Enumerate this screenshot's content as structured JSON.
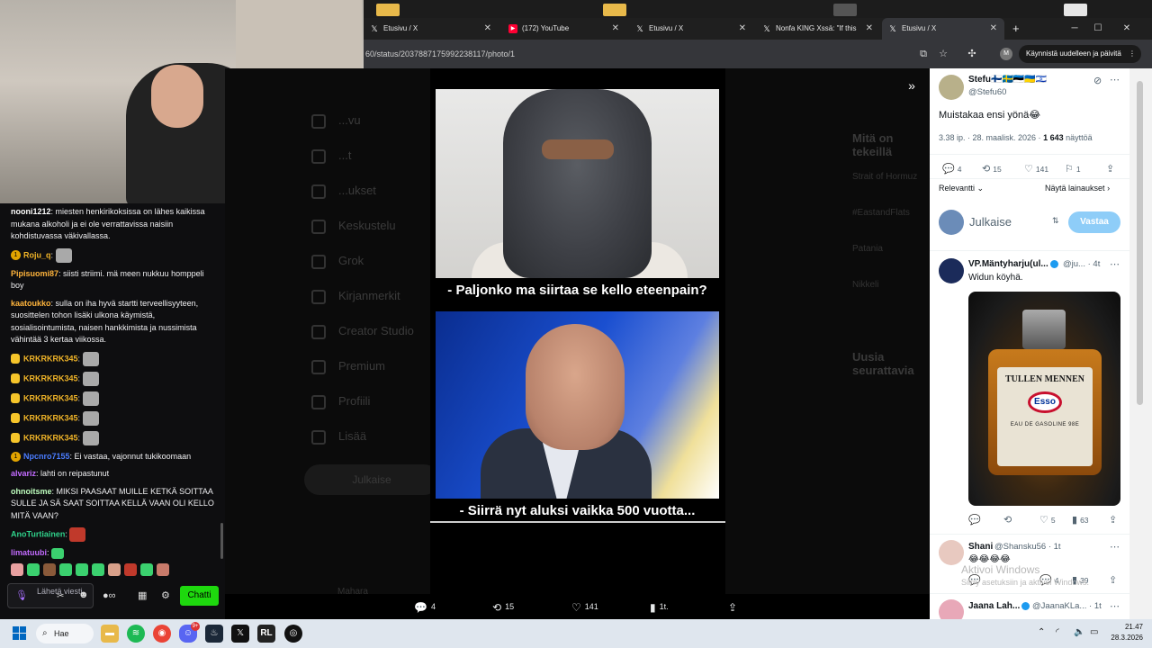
{
  "browser": {
    "tabs": [
      {
        "title": "Etusivu / X",
        "icon": "x-logo-icon"
      },
      {
        "title": "(172) YouTube",
        "icon": "youtube-icon"
      },
      {
        "title": "Etusivu / X",
        "icon": "x-logo-icon"
      },
      {
        "title": "Nonfa KING Xssä: \"If this",
        "icon": "x-logo-icon"
      },
      {
        "title": "Etusivu / X",
        "icon": "x-logo-icon",
        "active": true
      }
    ],
    "url": "60/status/2037887175992238117/photo/1",
    "restart_label": "Käynnistä uudelleen ja päivitä",
    "profile_initial": "M"
  },
  "chat": {
    "messages": [
      {
        "user": "nooni1212",
        "color": "#ffffff",
        "text": "miesten henkirikoksissa on lähes kaikissa mukana alkoholi ja ei ole verrattavissa naisiin kohdistuvassa väkivallassa."
      },
      {
        "user": "Roju_q",
        "color": "#f0b428",
        "badge": "1",
        "text": ""
      },
      {
        "user": "Pipisuomi87",
        "color": "#ffb43c",
        "text": "siisti striimi. mä meen nukkuu homppeli boy"
      },
      {
        "user": "kaatoukko",
        "color": "#ffb43c",
        "text": "sulla on iha hyvä startti terveellisyyteen, suosittelen tohon lisäki ulkona käymistä, sosialisointumista, naisen hankkimista ja nussimista vähintää 3 kertaa viikossa."
      },
      {
        "user": "KRKRKRK345",
        "color": "#f0b428",
        "text": ""
      },
      {
        "user": "KRKRKRK345",
        "color": "#f0b428",
        "text": ""
      },
      {
        "user": "KRKRKRK345",
        "color": "#f0b428",
        "text": ""
      },
      {
        "user": "KRKRKRK345",
        "color": "#f0b428",
        "text": ""
      },
      {
        "user": "KRKRKRK345",
        "color": "#f0b428",
        "text": ""
      },
      {
        "user": "Npcnro7155",
        "color": "#4a7cff",
        "badge": "1",
        "text": "Ei vastaa, vajonnut tukikoomaan"
      },
      {
        "user": "alvariz",
        "color": "#c36bff",
        "text": "lahti on reipastunut"
      },
      {
        "user": "ohnoitsme",
        "color": "#bfffbf",
        "text": "MIKSI PAASAAT MUILLE KETKÄ SOITTAA SULLE JA SÄ SAAT SOITTAA KELLÄ VAAN OLI KELLO MITÄ VAAN?"
      },
      {
        "user": "AnoTurtiainen",
        "color": "#2fd18a",
        "text": ""
      },
      {
        "user": "limatuubi",
        "color": "#c36bff",
        "text": ""
      }
    ],
    "input_placeholder": "Lähetä viesti",
    "send_label": "Chatti"
  },
  "x_bg": {
    "nav": [
      "...vu",
      "...t",
      "...ukset",
      "Keskustelu",
      "Grok",
      "Kirjanmerkit",
      "Creator Studio",
      "Premium",
      "Profiili",
      "Lisää"
    ],
    "post_label": "Julkaise",
    "right_title": "Mitä on tekeillä",
    "right_items": [
      "Strait of Hormuz",
      "#EastandFlats",
      "Patania",
      "Nikkeli"
    ],
    "who_title": "Uusia seurattavia",
    "bottom_user": "Mahara"
  },
  "viewer": {
    "caption_top": "- Paljonko ma siirtaa se kello eteenpain?",
    "caption_bottom": "- Siirrä nyt aluksi vaikka 500 vuotta...",
    "replies": "4",
    "reposts": "15",
    "likes": "141",
    "views": "1t."
  },
  "post": {
    "name": "Stefu🇫🇮🇸🇪🇪🇪🇺🇦🇮🇱",
    "handle": "@Stefu60",
    "text": "Muistakaa ensi yönä😂",
    "time": "3.38 ip. · 28. maalisk. 2026 ·",
    "views_count": "1 643",
    "views_label": "näyttöä",
    "stats": {
      "replies": "4",
      "reposts": "15",
      "likes": "141",
      "bookmarks": "1"
    },
    "sort_label": "Relevantti",
    "quotes_label": "Näytä lainaukset",
    "reply_placeholder": "Julkaise",
    "reply_button": "Vastaa"
  },
  "replies": [
    {
      "name": "VP.Mäntyharju(ul...",
      "handle": "@ju...",
      "time": "4t",
      "text": "Widun köyhä.",
      "stats": {
        "replies": "",
        "reposts": "",
        "likes": "5",
        "views": "63"
      },
      "image_title": "TULLEN MENNEN",
      "image_logo": "Esso",
      "image_sub": "EAU DE GASOLINE 98E"
    },
    {
      "name": "Shani",
      "handle": "@Shansku56",
      "time": "1t",
      "text": "😂😂😂😂",
      "stats": {
        "replies": "4",
        "views": "39"
      }
    },
    {
      "name": "Jaana Lah...",
      "handle": "@JaanaKLa...",
      "time": "1t",
      "text": ""
    }
  ],
  "watermark": {
    "title": "Aktivoi Windows",
    "sub": "Siirry asetuksiin ja aktivoi Windows."
  },
  "taskbar": {
    "search_label": "Hae",
    "time": "21.47",
    "date": "28.3.2026",
    "notify_count": "9+"
  }
}
